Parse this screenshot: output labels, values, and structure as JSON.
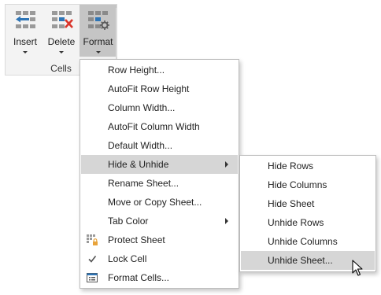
{
  "ribbon": {
    "buttons": {
      "insert": "Insert",
      "delete": "Delete",
      "format": "Format"
    },
    "group_label": "Cells"
  },
  "format_menu": {
    "items": [
      {
        "label": "Row Height..."
      },
      {
        "label": "AutoFit Row Height"
      },
      {
        "label": "Column Width..."
      },
      {
        "label": "AutoFit Column Width"
      },
      {
        "label": "Default Width..."
      },
      {
        "label": "Hide & Unhide",
        "highlighted": true,
        "has_submenu": true
      },
      {
        "label": "Rename Sheet..."
      },
      {
        "label": "Move or Copy Sheet..."
      },
      {
        "label": "Tab Color",
        "has_submenu": true
      },
      {
        "label": "Protect Sheet",
        "icon": "protect-sheet-icon"
      },
      {
        "label": "Lock Cell",
        "icon": "checkmark-icon"
      },
      {
        "label": "Format Cells...",
        "icon": "format-cells-icon"
      }
    ]
  },
  "hide_unhide_submenu": {
    "items": [
      {
        "label": "Hide Rows"
      },
      {
        "label": "Hide Columns"
      },
      {
        "label": "Hide Sheet"
      },
      {
        "label": "Unhide Rows"
      },
      {
        "label": "Unhide Columns"
      },
      {
        "label": "Unhide Sheet...",
        "highlighted": true
      }
    ]
  },
  "colors": {
    "highlight": "#d6d6d6",
    "format_button_active": "#c5c5c5",
    "icon_blue": "#2e75b6",
    "icon_red": "#d9352b",
    "icon_gray": "#9a9a9a",
    "icon_orange": "#e8a33a"
  }
}
